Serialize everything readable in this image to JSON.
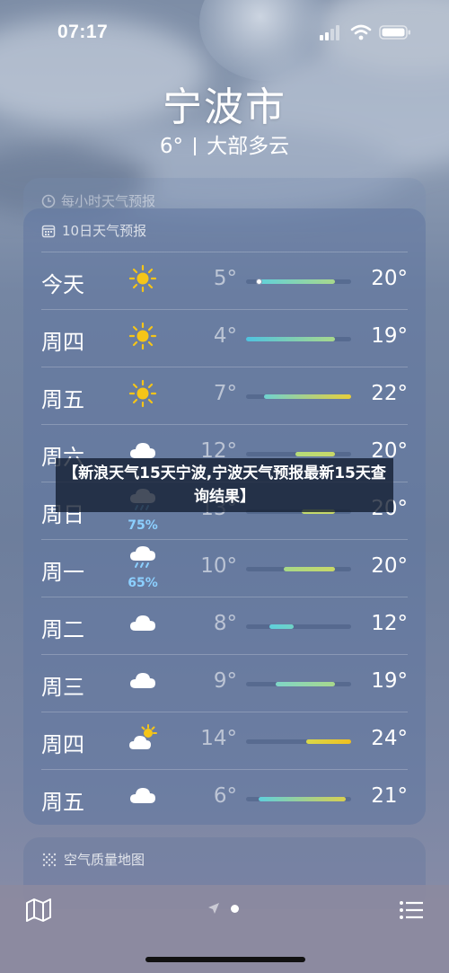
{
  "status_bar": {
    "time": "07:17"
  },
  "location": {
    "city": "宁波市",
    "temperature": "6°",
    "condition": "大部多云"
  },
  "hourly_section": {
    "title": "每小时天气预报"
  },
  "daily_forecast": {
    "title": "10日天气预报",
    "days": [
      {
        "day": "今天",
        "icon": "sun-icon",
        "precip": "",
        "low": "5°",
        "high": "20°",
        "range_start": 0.1,
        "range_end": 0.85,
        "fill": "linear-gradient(90deg,#5fd0dc,#a8d88c)",
        "current_marker": 0.12
      },
      {
        "day": "周四",
        "icon": "sun-icon",
        "precip": "",
        "low": "4°",
        "high": "19°",
        "range_start": 0.0,
        "range_end": 0.85,
        "fill": "linear-gradient(90deg,#4fc3e0,#a8d88c)"
      },
      {
        "day": "周五",
        "icon": "sun-icon",
        "precip": "",
        "low": "7°",
        "high": "22°",
        "range_start": 0.17,
        "range_end": 1.0,
        "fill": "linear-gradient(90deg,#6fd2d0,#e8cf3a)"
      },
      {
        "day": "周六",
        "icon": "cloud-icon",
        "precip": "",
        "low": "12°",
        "high": "20°",
        "range_start": 0.47,
        "range_end": 0.85,
        "fill": "linear-gradient(90deg,#b5dc7a,#c9d867)"
      },
      {
        "day": "周日",
        "icon": "rain-cloud-icon",
        "precip": "75%",
        "low": "13°",
        "high": "20°",
        "range_start": 0.53,
        "range_end": 0.85,
        "fill": "linear-gradient(90deg,#c2da6e,#c9d867)"
      },
      {
        "day": "周一",
        "icon": "rain-cloud-icon",
        "precip": "65%",
        "low": "10°",
        "high": "20°",
        "range_start": 0.36,
        "range_end": 0.85,
        "fill": "linear-gradient(90deg,#a6d888,#c9d867)"
      },
      {
        "day": "周二",
        "icon": "cloud-icon",
        "precip": "",
        "low": "8°",
        "high": "12°",
        "range_start": 0.22,
        "range_end": 0.45,
        "fill": "linear-gradient(90deg,#5fd0dc,#6fd2c6)"
      },
      {
        "day": "周三",
        "icon": "cloud-icon",
        "precip": "",
        "low": "9°",
        "high": "19°",
        "range_start": 0.28,
        "range_end": 0.85,
        "fill": "linear-gradient(90deg,#7fd6c8,#a8d88c)"
      },
      {
        "day": "周四",
        "icon": "sun-cloud-icon",
        "precip": "",
        "low": "14°",
        "high": "24°",
        "range_start": 0.57,
        "range_end": 1.0,
        "fill": "linear-gradient(90deg,#d8d84a,#f0c020)"
      },
      {
        "day": "周五",
        "icon": "cloud-icon",
        "precip": "",
        "low": "6°",
        "high": "21°",
        "range_start": 0.12,
        "range_end": 0.95,
        "fill": "linear-gradient(90deg,#5fd0dc,#d8d050)"
      }
    ]
  },
  "banner": {
    "text": "【新浪天气15天宁波,宁波天气预报最新15天查询结果】"
  },
  "air_quality": {
    "title": "空气质量地图"
  },
  "colors": {
    "precip": "#8cd0ff",
    "sun": "#f5c518",
    "bottom_bar": "#8c8aa0"
  }
}
